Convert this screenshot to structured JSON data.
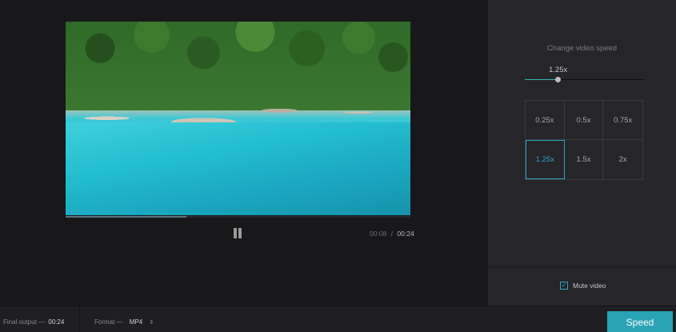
{
  "player": {
    "progress_fraction": 0.35,
    "current_time": "00:08",
    "time_separator": "/",
    "total_time": "00:24",
    "icons": {
      "pause": "pause-icon"
    }
  },
  "speed_panel": {
    "title": "Change video speed",
    "slider_value": "1.25x",
    "slider_level_fraction": 0.28,
    "options": [
      "0.25x",
      "0.5x",
      "0.75x",
      "1.25x",
      "1.5x",
      "2x"
    ],
    "selected": "1.25x",
    "mute_label": "Mute video",
    "mute_checked": true,
    "check_glyph": "✓"
  },
  "bottom_bar": {
    "final_output_label": "Final output —",
    "final_output_value": "00:24",
    "format_label": "Format —",
    "format_value": "MP4",
    "format_arrows": "⇕",
    "speed_button_label": "Speed"
  },
  "colors": {
    "accent": "#2aa6c4",
    "button": "#2aa3b7",
    "slider_fill": "#2fb8b2"
  }
}
